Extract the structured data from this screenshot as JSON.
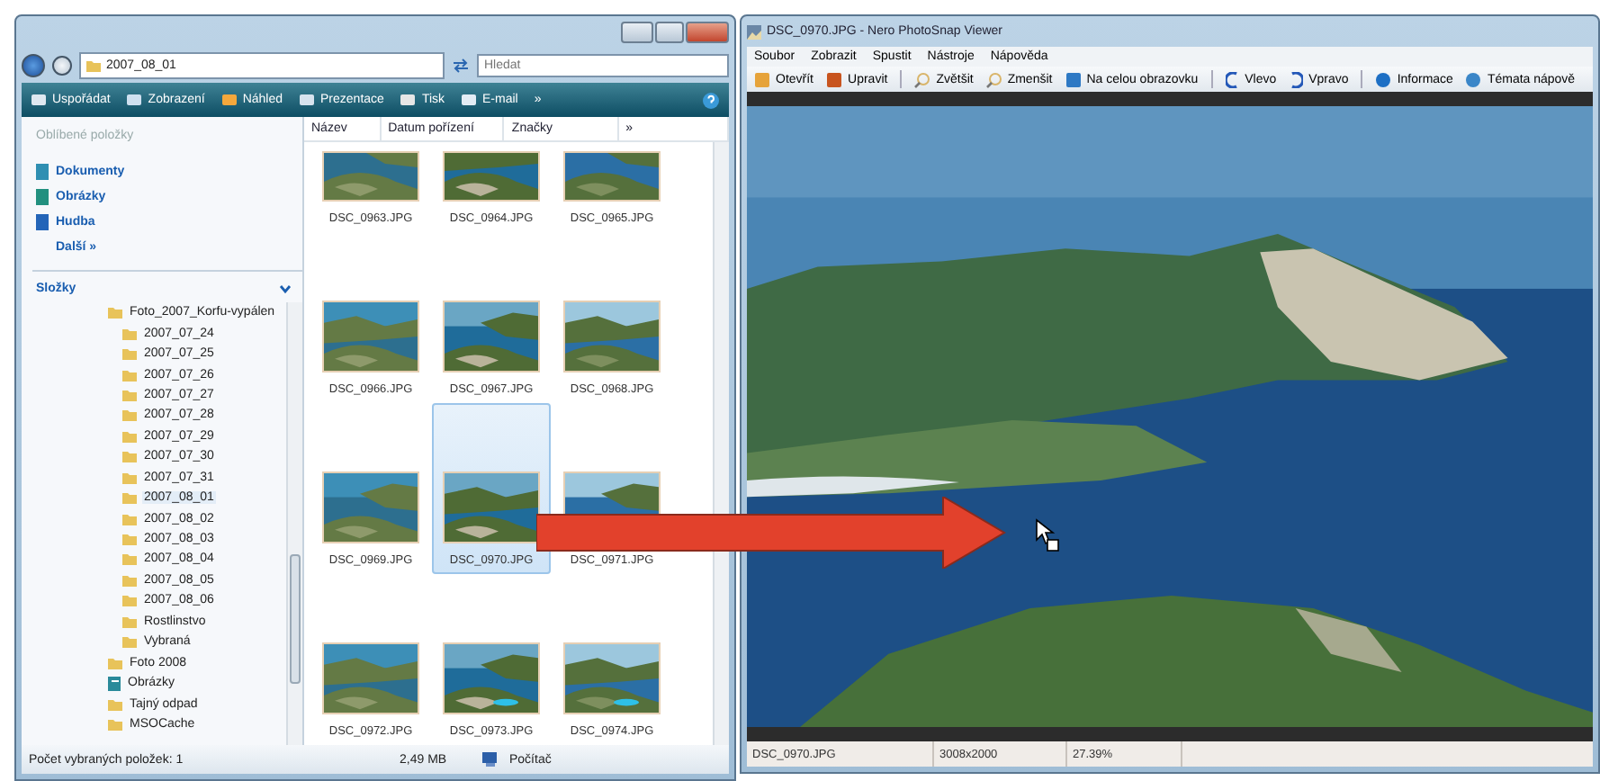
{
  "explorer": {
    "address": "2007_08_01",
    "search": {
      "placeholder": "Hledat"
    },
    "toolbar": [
      {
        "label": "Uspořádat",
        "kind": "organize"
      },
      {
        "label": "Zobrazení",
        "kind": "views"
      },
      {
        "label": "Náhled",
        "kind": "preview"
      },
      {
        "label": "Prezentace",
        "kind": "slideshow"
      },
      {
        "label": "Tisk",
        "kind": "print"
      },
      {
        "label": "E-mail",
        "kind": "mail"
      },
      {
        "label": "»",
        "kind": "more"
      },
      {
        "kind": "help"
      }
    ],
    "favorites_title": "Oblíbené položky",
    "favorites": [
      {
        "label": "Dokumenty",
        "kind": "documents"
      },
      {
        "label": "Obrázky",
        "kind": "pictures"
      },
      {
        "label": "Hudba",
        "kind": "music"
      }
    ],
    "more_link": "Další »",
    "folders_title": "Složky",
    "tree": [
      {
        "label": "Foto_2007_Korfu-vypálen",
        "kind": "folder",
        "selected": false,
        "children": [
          {
            "label": "2007_07_24",
            "kind": "folder",
            "selected": false
          },
          {
            "label": "2007_07_25",
            "kind": "folder",
            "selected": false
          },
          {
            "label": "2007_07_26",
            "kind": "folder",
            "selected": false
          },
          {
            "label": "2007_07_27",
            "kind": "folder",
            "selected": false
          },
          {
            "label": "2007_07_28",
            "kind": "folder",
            "selected": false
          },
          {
            "label": "2007_07_29",
            "kind": "folder",
            "selected": false
          },
          {
            "label": "2007_07_30",
            "kind": "folder",
            "selected": false
          },
          {
            "label": "2007_07_31",
            "kind": "folder",
            "selected": false
          },
          {
            "label": "2007_08_01",
            "kind": "folder",
            "selected": true
          },
          {
            "label": "2007_08_02",
            "kind": "folder",
            "selected": false
          },
          {
            "label": "2007_08_03",
            "kind": "folder",
            "selected": false
          },
          {
            "label": "2007_08_04",
            "kind": "folder",
            "selected": false
          },
          {
            "label": "2007_08_05",
            "kind": "folder",
            "selected": false
          },
          {
            "label": "2007_08_06",
            "kind": "folder",
            "selected": false
          },
          {
            "label": "Rostlinstvo",
            "kind": "folder",
            "selected": false
          },
          {
            "label": "Vybraná",
            "kind": "folder",
            "selected": false
          }
        ]
      },
      {
        "label": "Foto 2008",
        "kind": "folder",
        "selected": false
      },
      {
        "label": "Obrázky",
        "kind": "library",
        "selected": false
      },
      {
        "label": "Tajný odpad",
        "kind": "folder",
        "selected": false
      },
      {
        "label": "MSOCache",
        "kind": "folder",
        "selected": false
      }
    ],
    "columns": [
      "Název",
      "Datum pořízení",
      "Značky",
      "»"
    ],
    "files": [
      {
        "name": "DSC_0963.JPG",
        "selected": false
      },
      {
        "name": "DSC_0964.JPG",
        "selected": false
      },
      {
        "name": "DSC_0965.JPG",
        "selected": false
      },
      {
        "name": "DSC_0966.JPG",
        "selected": false
      },
      {
        "name": "DSC_0967.JPG",
        "selected": false
      },
      {
        "name": "DSC_0968.JPG",
        "selected": false
      },
      {
        "name": "DSC_0969.JPG",
        "selected": false
      },
      {
        "name": "DSC_0970.JPG",
        "selected": true
      },
      {
        "name": "DSC_0971.JPG",
        "selected": false
      },
      {
        "name": "DSC_0972.JPG",
        "selected": false
      },
      {
        "name": "DSC_0973.JPG",
        "selected": false
      },
      {
        "name": "DSC_0974.JPG",
        "selected": false
      }
    ],
    "status": {
      "selection": "Počet vybraných položek: 1",
      "size": "2,49 MB",
      "location": "Počítač"
    }
  },
  "viewer": {
    "title": "DSC_0970.JPG - Nero PhotoSnap Viewer",
    "menu": [
      "Soubor",
      "Zobrazit",
      "Spustit",
      "Nástroje",
      "Nápověda"
    ],
    "toolbar": [
      {
        "label": "Otevřít",
        "kind": "open"
      },
      {
        "label": "Upravit",
        "kind": "edit"
      },
      {
        "label": "Zvětšit",
        "kind": "zoom"
      },
      {
        "label": "Zmenšit",
        "kind": "zoom"
      },
      {
        "label": "Na celou obrazovku",
        "kind": "fullscreen"
      },
      {
        "label": "Vlevo",
        "kind": "rotate-left"
      },
      {
        "label": "Vpravo",
        "kind": "rotate-right"
      },
      {
        "label": "Informace",
        "kind": "info"
      },
      {
        "label": "Témata nápově",
        "kind": "help"
      }
    ],
    "status": [
      "DSC_0970.JPG",
      "3008x2000",
      "27.39%"
    ]
  }
}
